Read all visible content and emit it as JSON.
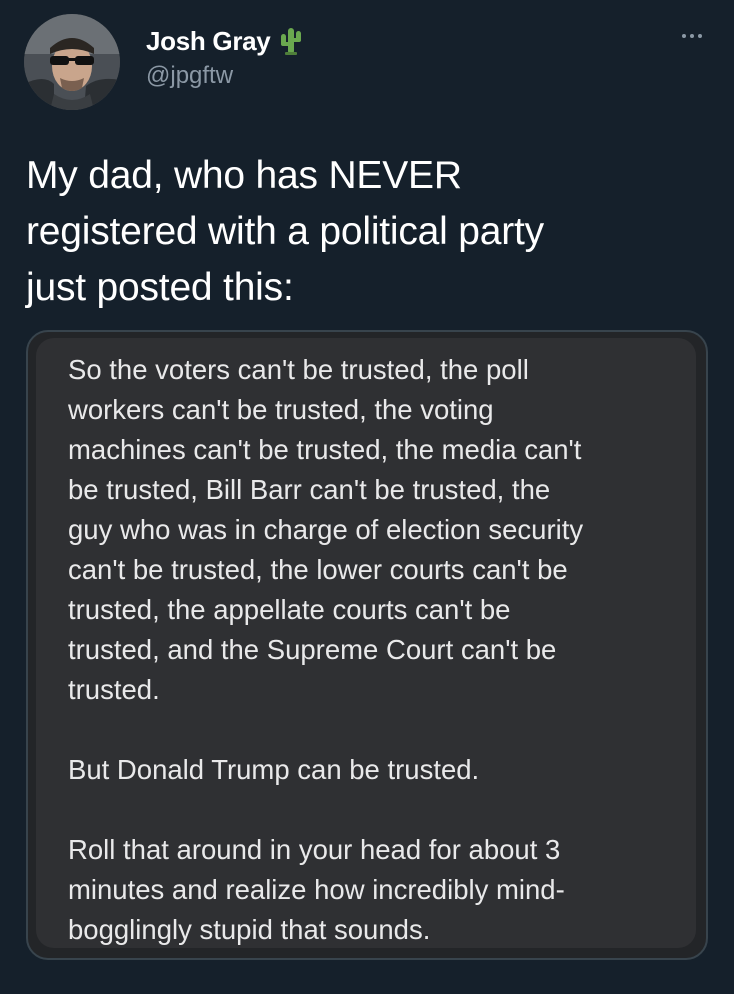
{
  "author": {
    "display_name": "Josh Gray",
    "handle": "@jpgftw",
    "badge_icon": "cactus-icon",
    "avatar_icon": "profile-avatar"
  },
  "more_icon": "more-options-icon",
  "tweet": {
    "lines": [
      "My dad, who has NEVER",
      "registered with a political party",
      "just posted this:"
    ]
  },
  "screenshot": {
    "paragraph1": [
      "So the voters can't be trusted, the poll",
      "workers can't be trusted, the voting",
      "machines can't be trusted, the media can't",
      "be trusted, Bill Barr can't be trusted, the",
      "guy who was in charge of election security",
      "can't be trusted, the lower courts can't be",
      "trusted, the appellate courts can't be",
      "trusted, and the Supreme Court can't be",
      "trusted."
    ],
    "paragraph2": [
      "But Donald Trump can be trusted."
    ],
    "paragraph3": [
      "Roll that around in your head for about 3",
      "minutes and realize how incredibly mind-",
      "bogglingly stupid that sounds."
    ]
  },
  "colors": {
    "background": "#15202b",
    "secondary_text": "#8b98a5",
    "media_background": "#2f3033",
    "cactus_green": "#6aa84f"
  }
}
